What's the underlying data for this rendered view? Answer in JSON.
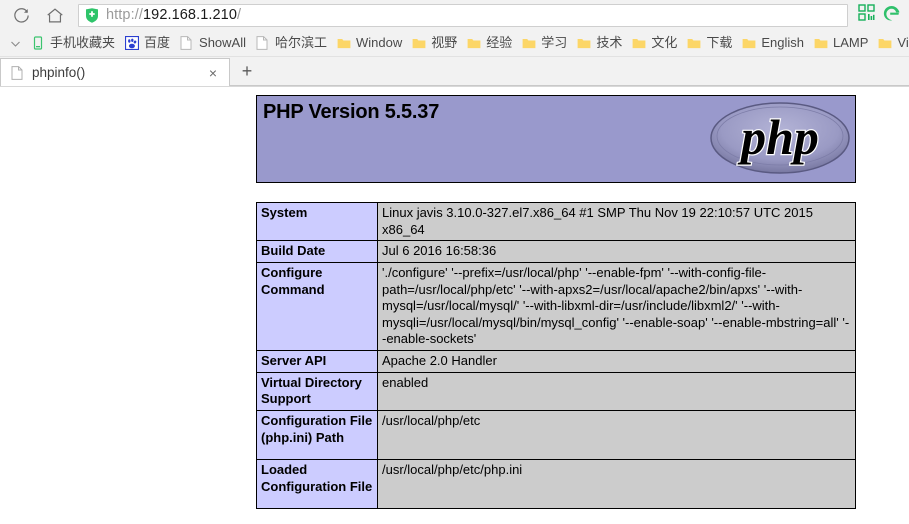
{
  "browser": {
    "toolbar": {
      "reload_icon": "reload-icon",
      "home_icon": "home-icon",
      "security_icon": "green-shield-check-icon",
      "url_scheme": "http://",
      "url_host": "192.168.1.210",
      "url_path": "/",
      "qr_icon": "qr-code-icon",
      "browser_logo_icon": "green-e-browser-icon"
    },
    "bookmarks": {
      "overflow_caret": "chevron-down-icon",
      "items": [
        {
          "label": "手机收藏夹",
          "icon": "mobile-phone-icon"
        },
        {
          "label": "百度",
          "icon": "baidu-paw-icon"
        },
        {
          "label": "ShowAll",
          "icon": "page-icon"
        },
        {
          "label": "哈尔滨工",
          "icon": "page-icon"
        },
        {
          "label": "Window",
          "icon": "folder-icon"
        },
        {
          "label": "视野",
          "icon": "folder-icon"
        },
        {
          "label": "经验",
          "icon": "folder-icon"
        },
        {
          "label": "学习",
          "icon": "folder-icon"
        },
        {
          "label": "技术",
          "icon": "folder-icon"
        },
        {
          "label": "文化",
          "icon": "folder-icon"
        },
        {
          "label": "下载",
          "icon": "folder-icon"
        },
        {
          "label": "English",
          "icon": "folder-icon"
        },
        {
          "label": "LAMP",
          "icon": "folder-icon"
        },
        {
          "label": "VisualSt",
          "icon": "folder-icon"
        }
      ]
    },
    "tabs": {
      "active": {
        "title": "phpinfo()",
        "favicon": "page-icon",
        "close_label": "×"
      },
      "new_tab_label": "+"
    }
  },
  "page": {
    "banner": {
      "version_title": "PHP Version 5.5.37",
      "logo_text": "php"
    },
    "table": {
      "rows": [
        {
          "key": "System",
          "value": "Linux javis 3.10.0-327.el7.x86_64 #1 SMP Thu Nov 19 22:10:57 UTC 2015 x86_64"
        },
        {
          "key": "Build Date",
          "value": "Jul 6 2016 16:58:36"
        },
        {
          "key": "Configure Command",
          "value": "'./configure' '--prefix=/usr/local/php' '--enable-fpm' '--with-config-file-path=/usr/local/php/etc' '--with-apxs2=/usr/local/apache2/bin/apxs' '--with-mysql=/usr/local/mysql/' '--with-libxml-dir=/usr/include/libxml2/' '--with-mysqli=/usr/local/mysql/bin/mysql_config' '--enable-soap' '--enable-mbstring=all' '--enable-sockets'"
        },
        {
          "key": "Server API",
          "value": "Apache 2.0 Handler"
        },
        {
          "key": "Virtual Directory Support",
          "value": "enabled"
        },
        {
          "key": "Configuration File (php.ini) Path",
          "value": "/usr/local/php/etc"
        },
        {
          "key": "Loaded Configuration File",
          "value": "/usr/local/php/etc/php.ini"
        }
      ]
    }
  },
  "colors": {
    "banner_bg": "#9999cc",
    "key_cell_bg": "#ccccff",
    "value_cell_bg": "#cccccc",
    "chrome_bg": "#f2f2f2",
    "shield_green": "#2ec46a"
  }
}
